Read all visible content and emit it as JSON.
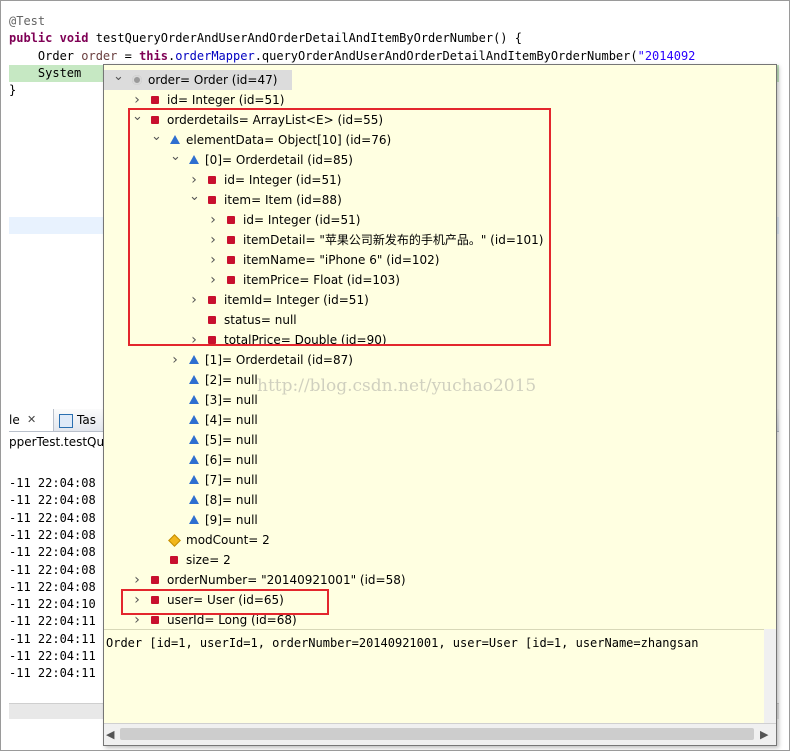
{
  "editor": {
    "lines": [
      "@Test",
      "public void testQueryOrderAndUserAndOrderDetailAndItemByOrderNumber() {",
      "    Order order = this.orderMapper.queryOrderAndUserAndOrderDetailAndItemByOrderNumber(\"2014092",
      "    System",
      "}"
    ],
    "l1_kw1": "public",
    "l1_kw2": "void",
    "l1_rest": " testQueryOrderAndUserAndOrderDetailAndItemByOrderNumber() {",
    "l2_a": "    Order ",
    "l2_var": "order",
    "l2_b": " = ",
    "l2_this": "this",
    "l2_c": ".",
    "l2_field": "orderMapper",
    "l2_d": ".queryOrderAndUserAndOrderDetailAndItemByOrderNumber(",
    "l2_str": "\"2014092"
  },
  "bottom": {
    "tab1_label": "le",
    "tab1_close": "✕",
    "tab2_label": "Tas",
    "title": "pperTest.testQue",
    "console_lines": [
      "-11 22:04:08",
      "-11 22:04:08",
      "-11 22:04:08",
      "-11 22:04:08",
      "-11 22:04:08",
      "-11 22:04:08",
      "-11 22:04:08",
      "-11 22:04:10",
      "-11 22:04:11",
      "-11 22:04:11",
      "-11 22:04:11",
      "-11 22:04:11"
    ]
  },
  "inspector": {
    "rows": [
      {
        "label": "order= Order  (id=47)",
        "icon": "circle-icon",
        "twisty": "expanded"
      },
      {
        "label": "id= Integer  (id=51)",
        "icon": "square-icon",
        "twisty": "collapsed"
      },
      {
        "label": "orderdetails= ArrayList<E>  (id=55)",
        "icon": "square-icon",
        "twisty": "expanded"
      },
      {
        "label": "elementData= Object[10]  (id=76)",
        "icon": "triangle-icon",
        "twisty": "expanded"
      },
      {
        "label": "[0]= Orderdetail  (id=85)",
        "icon": "triangle-icon",
        "twisty": "expanded"
      },
      {
        "label": "id= Integer  (id=51)",
        "icon": "square-icon",
        "twisty": "collapsed"
      },
      {
        "label": "item= Item  (id=88)",
        "icon": "square-icon",
        "twisty": "expanded"
      },
      {
        "label": "id= Integer  (id=51)",
        "icon": "square-icon",
        "twisty": "collapsed"
      },
      {
        "label": "itemDetail= \"苹果公司新发布的手机产品。\" (id=101)",
        "icon": "square-icon",
        "twisty": "collapsed"
      },
      {
        "label": "itemName= \"iPhone 6\" (id=102)",
        "icon": "square-icon",
        "twisty": "collapsed"
      },
      {
        "label": "itemPrice= Float  (id=103)",
        "icon": "square-icon",
        "twisty": "collapsed"
      },
      {
        "label": "itemId= Integer  (id=51)",
        "icon": "square-icon",
        "twisty": "collapsed"
      },
      {
        "label": "status= null",
        "icon": "square-icon",
        "twisty": "none"
      },
      {
        "label": "totalPrice= Double  (id=90)",
        "icon": "square-icon",
        "twisty": "collapsed"
      },
      {
        "label": "[1]= Orderdetail  (id=87)",
        "icon": "triangle-icon",
        "twisty": "collapsed"
      },
      {
        "label": "[2]= null",
        "icon": "triangle-icon",
        "twisty": "none"
      },
      {
        "label": "[3]= null",
        "icon": "triangle-icon",
        "twisty": "none"
      },
      {
        "label": "[4]= null",
        "icon": "triangle-icon",
        "twisty": "none"
      },
      {
        "label": "[5]= null",
        "icon": "triangle-icon",
        "twisty": "none"
      },
      {
        "label": "[6]= null",
        "icon": "triangle-icon",
        "twisty": "none"
      },
      {
        "label": "[7]= null",
        "icon": "triangle-icon",
        "twisty": "none"
      },
      {
        "label": "[8]= null",
        "icon": "triangle-icon",
        "twisty": "none"
      },
      {
        "label": "[9]= null",
        "icon": "triangle-icon",
        "twisty": "none"
      },
      {
        "label": "modCount= 2",
        "icon": "diamond-icon",
        "twisty": "none"
      },
      {
        "label": "size= 2",
        "icon": "square-icon",
        "twisty": "none"
      },
      {
        "label": "orderNumber= \"20140921001\" (id=58)",
        "icon": "square-icon",
        "twisty": "collapsed"
      },
      {
        "label": "user= User  (id=65)",
        "icon": "square-icon",
        "twisty": "collapsed"
      },
      {
        "label": "userId= Long  (id=68)",
        "icon": "square-icon",
        "twisty": "collapsed"
      }
    ],
    "details": "Order [id=1, userId=1, orderNumber=20140921001, user=User [id=1, userName=zhangsan",
    "scroll_left": "◀",
    "scroll_right": "▶"
  },
  "watermark": "http://blog.csdn.net/yuchao2015",
  "colors": {
    "annotation_box": "#e3262d",
    "popup_background": "#ffffe1",
    "keyword": "#7f0055",
    "field": "#0000c0"
  }
}
